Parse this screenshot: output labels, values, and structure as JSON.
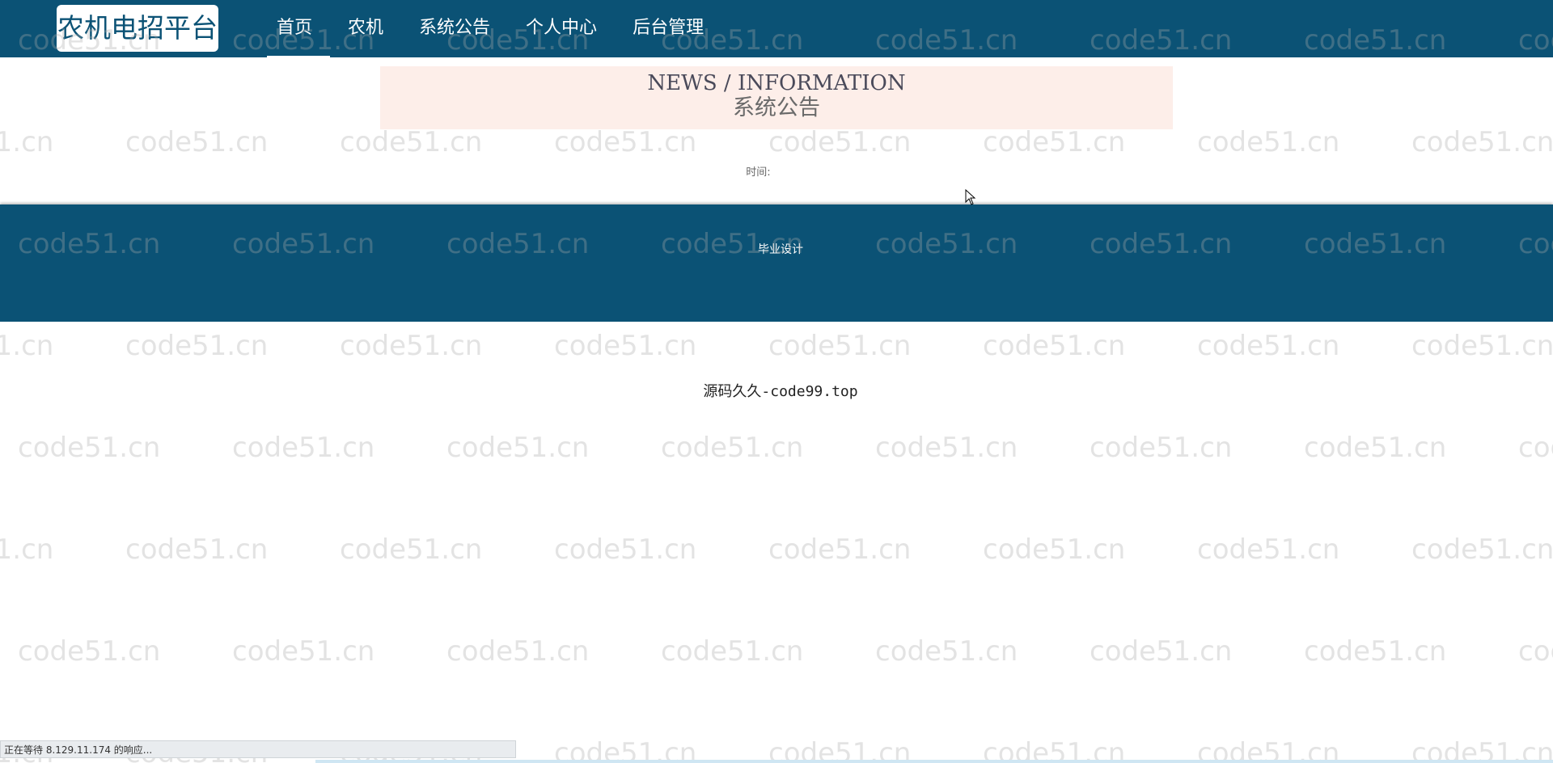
{
  "header": {
    "brand": "农机电招平台",
    "nav": [
      {
        "label": "首页",
        "active": true
      },
      {
        "label": "农机",
        "active": false
      },
      {
        "label": "系统公告",
        "active": false
      },
      {
        "label": "个人中心",
        "active": false
      },
      {
        "label": "后台管理",
        "active": false
      }
    ]
  },
  "banner": {
    "title_en": "NEWS / INFORMATION",
    "title_cn": "系统公告"
  },
  "article": {
    "time_label": "时间:",
    "content": "毕业设计"
  },
  "footer": {
    "text": "源码久久-code99.top"
  },
  "watermark": {
    "text": "code51.cn"
  },
  "statusbar": {
    "text": "正在等待 8.129.11.174 的响应..."
  },
  "colors": {
    "primary": "#0b5275",
    "banner_bg": "#fdeee9"
  }
}
